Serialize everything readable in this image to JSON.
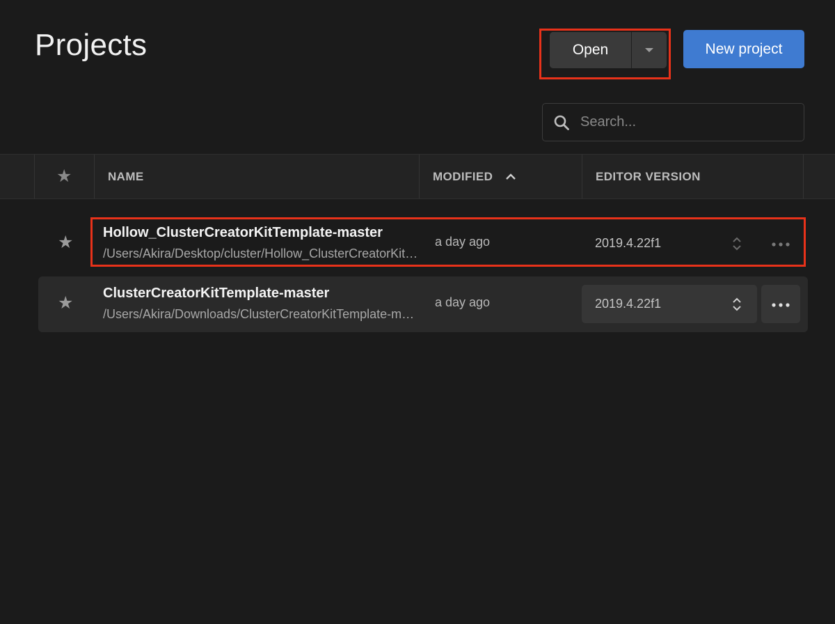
{
  "header": {
    "title": "Projects",
    "open_label": "Open",
    "new_project_label": "New project"
  },
  "search": {
    "placeholder": "Search...",
    "value": ""
  },
  "table": {
    "columns": {
      "name": "NAME",
      "modified": "MODIFIED",
      "editor_version": "EDITOR VERSION"
    },
    "rows": [
      {
        "name": "Hollow_ClusterCreatorKitTemplate-master",
        "path": "/Users/Akira/Desktop/cluster/Hollow_ClusterCreatorKitTemplate-master",
        "modified": "a day ago",
        "editor_version": "2019.4.22f1"
      },
      {
        "name": "ClusterCreatorKitTemplate-master",
        "path": "/Users/Akira/Downloads/ClusterCreatorKitTemplate-master",
        "modified": "a day ago",
        "editor_version": "2019.4.22f1"
      }
    ]
  },
  "icons": {
    "search": "search-icon",
    "star": "star-icon",
    "sort": "chevron-up-icon",
    "dropdown": "caret-down-icon",
    "version_select": "updown-chevron-icon",
    "more": "ellipsis-icon"
  },
  "colors": {
    "background": "#1b1b1b",
    "primary": "#3f7bd1",
    "highlight": "#e8321a"
  }
}
